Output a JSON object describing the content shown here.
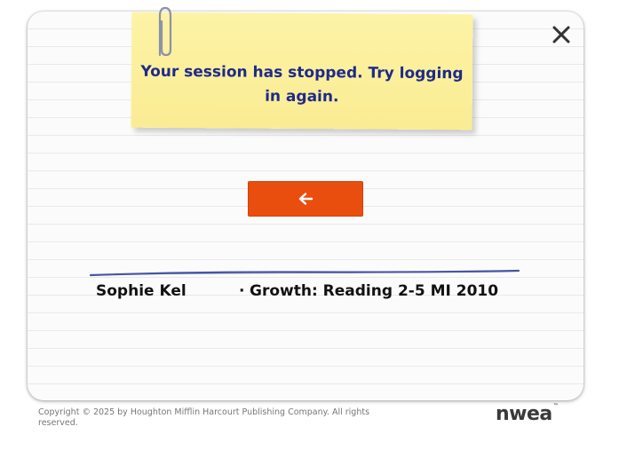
{
  "dialog": {
    "message": "Your session has stopped. Try logging in again.",
    "close_icon": "close-icon",
    "back_icon": "arrow-left-icon",
    "back_color": "#e94e0f"
  },
  "session": {
    "student_name": "Sophie Kel",
    "separator": "·",
    "test_name": "Growth: Reading 2-5 MI 2010"
  },
  "footer": {
    "copyright": "Copyright © 2025 by Houghton Mifflin Harcourt Publishing Company. All rights reserved.",
    "logo_text": "nwea",
    "logo_mark": "™"
  },
  "colors": {
    "message_text": "#1f2a8a",
    "sticky_note": "#faec93",
    "pen_line": "#2b3690"
  }
}
